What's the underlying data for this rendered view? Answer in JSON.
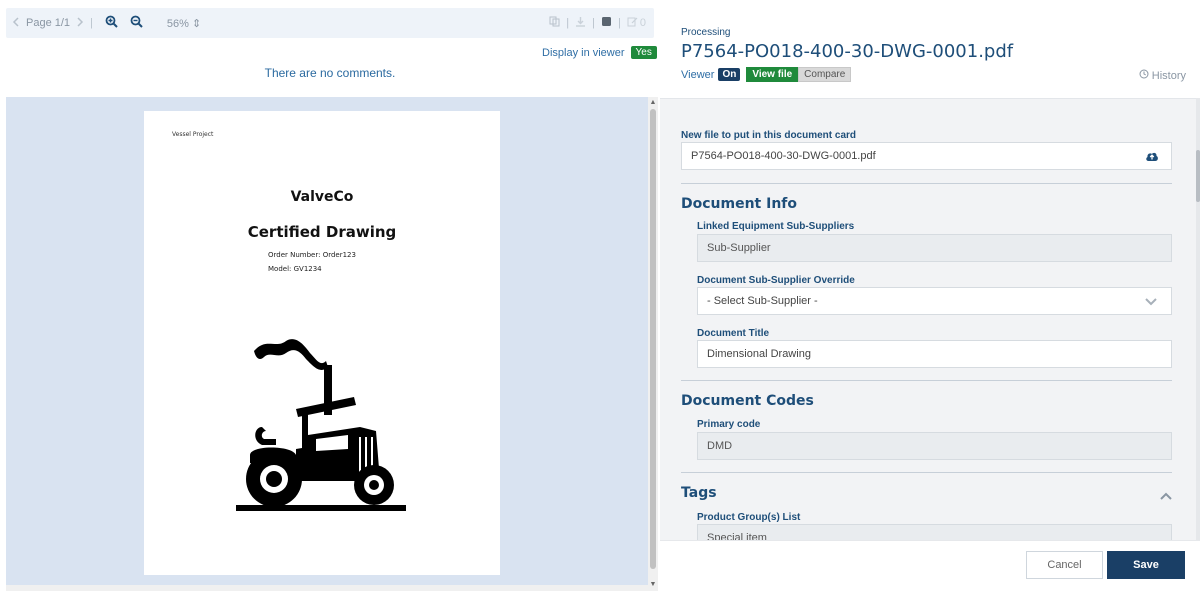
{
  "toolbar": {
    "prev_icon": "chevron-left-icon",
    "page_label": "Page 1/1",
    "next_icon": "chevron-right-icon",
    "zoom_in_icon": "zoom-in-icon",
    "zoom_out_icon": "zoom-out-icon",
    "zoom_value": "56%",
    "right_count": "0"
  },
  "display_in_viewer": {
    "label": "Display in viewer",
    "value": "Yes"
  },
  "comments": {
    "empty_text": "There are no comments."
  },
  "pdf_page": {
    "header": "Vessel Project",
    "title1": "ValveCo",
    "title2": "Certified Drawing",
    "order_line": "Order Number: Order123",
    "model_line": "Model: GV1234"
  },
  "panel": {
    "status": "Processing",
    "filename": "P7564-PO018-400-30-DWG-0001.pdf",
    "viewer_label": "Viewer",
    "viewer_state": "On",
    "view_file": "View file",
    "compare": "Compare",
    "history": "History"
  },
  "form": {
    "new_file_label": "New file to put in this document card",
    "new_file_value": "P7564-PO018-400-30-DWG-0001.pdf",
    "doc_info_title": "Document Info",
    "linked_label": "Linked Equipment Sub-Suppliers",
    "linked_value": "Sub-Supplier",
    "override_label": "Document Sub-Supplier Override",
    "override_value": "- Select Sub-Supplier -",
    "title_label": "Document Title",
    "title_value": "Dimensional Drawing",
    "codes_title": "Document Codes",
    "primary_label": "Primary code",
    "primary_value": "DMD",
    "tags_title": "Tags",
    "product_label": "Product Group(s) List",
    "product_value": "Special item"
  },
  "footer": {
    "cancel": "Cancel",
    "save": "Save"
  },
  "colors": {
    "brand_dark": "#1a3f66",
    "success": "#1f8a3b",
    "link": "#2f6ea5"
  }
}
